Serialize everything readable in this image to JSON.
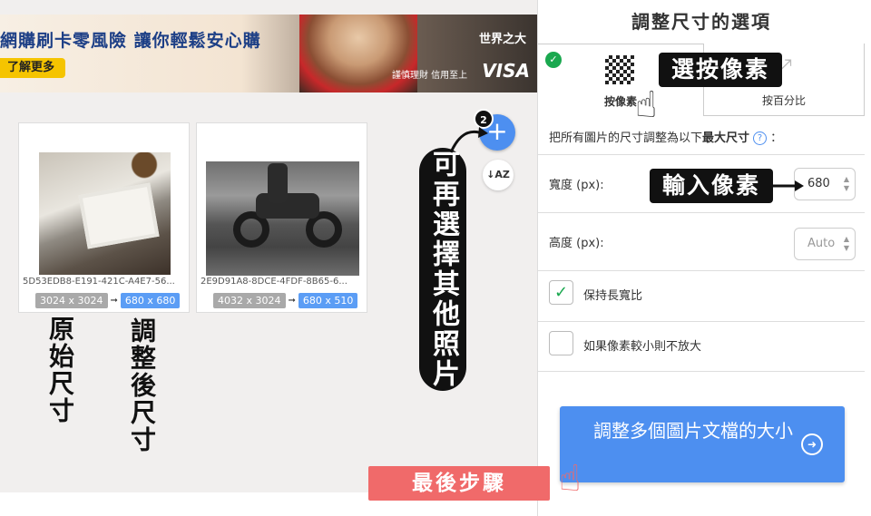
{
  "ad": {
    "headline": "網購刷卡零風險 讓你輕鬆安心購",
    "cta": "了解更多",
    "brand": "世界之大",
    "subtext": "謹慎理財 信用至上",
    "visa": "VISA"
  },
  "images": [
    {
      "filename": "5D53EDB8-E191-421C-A4E7-56...",
      "original": "3024 x 3024",
      "resized": "680 x 680"
    },
    {
      "filename": "2E9D91A8-8DCE-4FDF-8B65-6...",
      "original": "4032 x 3024",
      "resized": "680 x 510"
    }
  ],
  "toolbar": {
    "add_badge": "2",
    "add_symbol": "+",
    "sort_symbol": "↓AZ"
  },
  "panel": {
    "title": "調整尺寸的選項",
    "tab_pixels": "按像素",
    "tab_percent": "按百分比",
    "max_prefix": "把所有圖片的尺寸調整為以下",
    "max_bold": "最大尺寸",
    "max_suffix": "：",
    "help": "?",
    "width_label": "寬度 (px):",
    "width_value": "680",
    "height_label": "高度 (px):",
    "height_placeholder": "Auto",
    "keep_ratio_label": "保持長寬比",
    "keep_ratio_mark": "✓",
    "no_enlarge_label": "如果像素較小則不放大",
    "resize_button": "調整多個圖片文檔的大小",
    "resize_go": "➜"
  },
  "annotations": {
    "original_size": "原始尺寸",
    "resized_size": "調整後尺寸",
    "choose_more": "可再選擇其他照片",
    "choose_pixels": "選按像素",
    "enter_pixels": "輸入像素",
    "final_step": "最後步驟"
  },
  "colors": {
    "accent": "#4d8ff0",
    "check": "#1aa84f",
    "callout_red": "#f06a6a"
  },
  "icons": [
    "check-circle-icon",
    "pixel-grid-icon",
    "resize-arrows-icon",
    "help-icon",
    "plus-icon",
    "sort-az-icon",
    "arrow-right-circle-icon",
    "pointing-hand-icon"
  ]
}
